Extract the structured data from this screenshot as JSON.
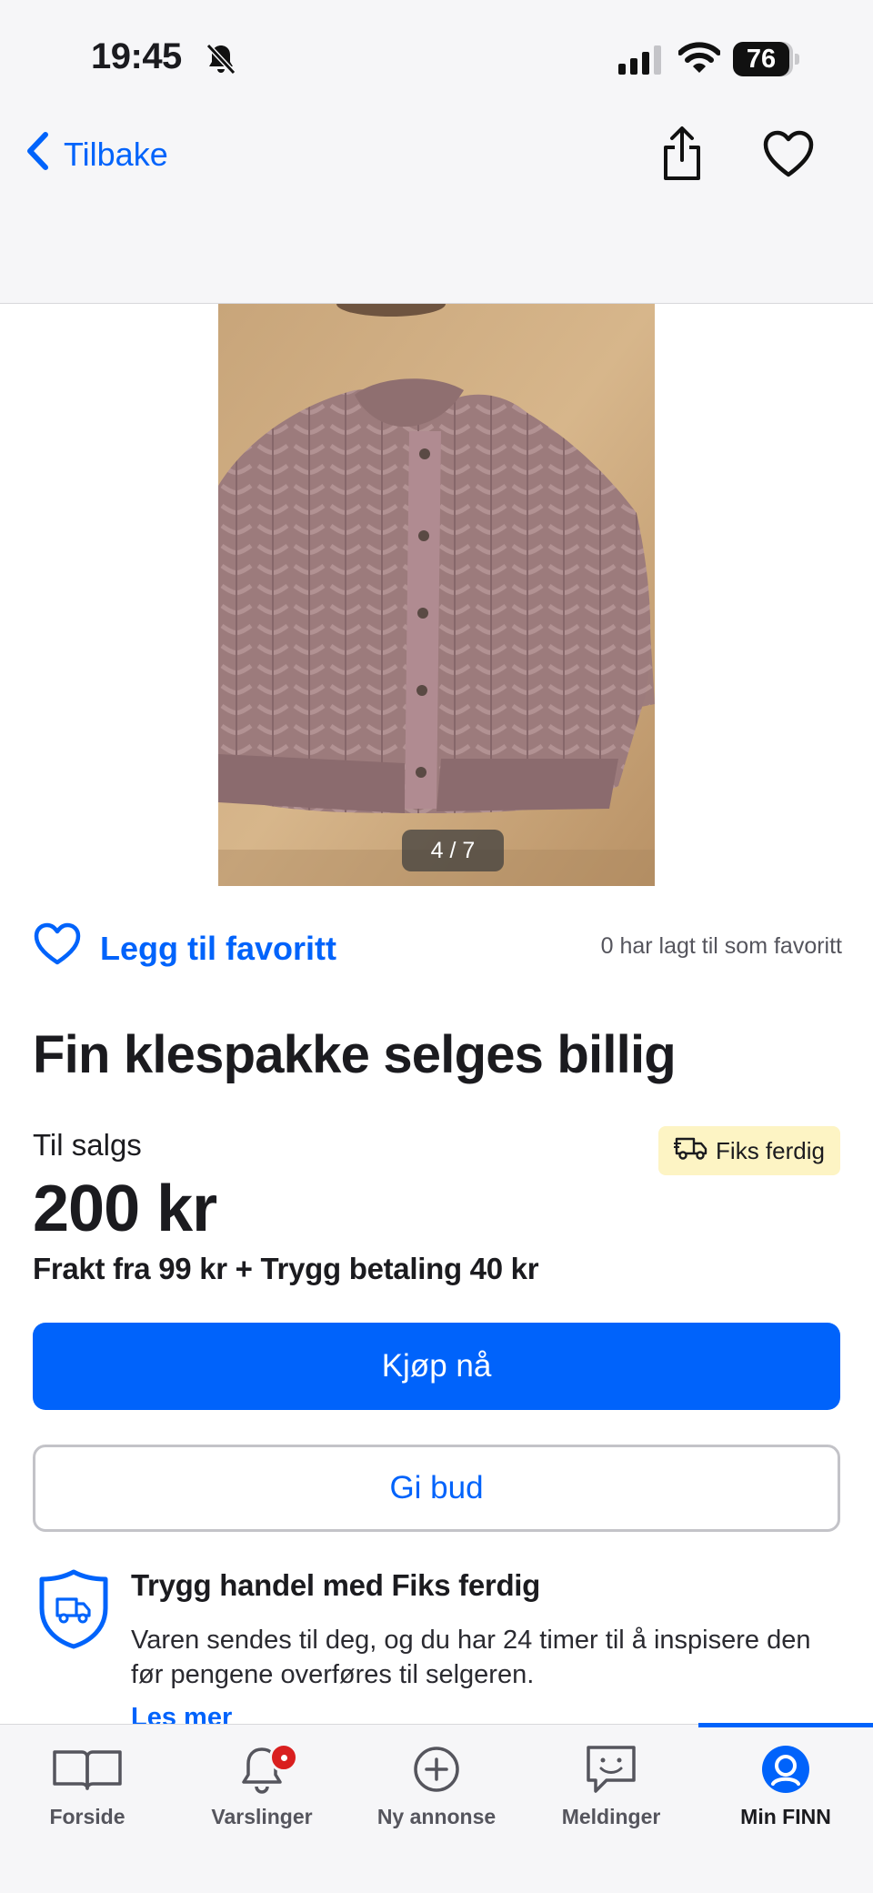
{
  "status_bar": {
    "time": "19:45",
    "battery": "76",
    "icons": [
      "bell-off-icon",
      "signal-icon",
      "wifi-icon",
      "battery-icon"
    ]
  },
  "nav": {
    "back_label": "Tilbake",
    "icons": [
      "chevron-left-icon",
      "share-icon",
      "heart-outline-icon"
    ]
  },
  "gallery": {
    "counter": "4 / 7"
  },
  "favorite": {
    "label": "Legg til favoritt",
    "count_text": "0 har lagt til som favoritt"
  },
  "listing": {
    "title": "Fin klespakke selges billig",
    "status": "Til salgs",
    "badge": "Fiks ferdig",
    "price": "200 kr",
    "shipping": "Frakt fra 99 kr + Trygg betaling 40 kr"
  },
  "actions": {
    "buy": "Kjøp nå",
    "bid": "Gi bud"
  },
  "safe_trade": {
    "title": "Trygg handel med Fiks ferdig",
    "text": "Varen sendes til deg, og du har 24 timer til å inspisere den før pengene overføres til selgeren.",
    "read_more": "Les mer"
  },
  "tabs": [
    {
      "label": "Forside",
      "icon": "book-icon",
      "active": false
    },
    {
      "label": "Varslinger",
      "icon": "bell-icon",
      "active": false
    },
    {
      "label": "Ny annonse",
      "icon": "plus-circle-icon",
      "active": false
    },
    {
      "label": "Meldinger",
      "icon": "chat-icon",
      "active": false
    },
    {
      "label": "Min FINN",
      "icon": "profile-icon",
      "active": true
    }
  ],
  "colors": {
    "accent": "#0063fb",
    "badge_bg": "#fdf4c4",
    "notification": "#d91f1f"
  }
}
